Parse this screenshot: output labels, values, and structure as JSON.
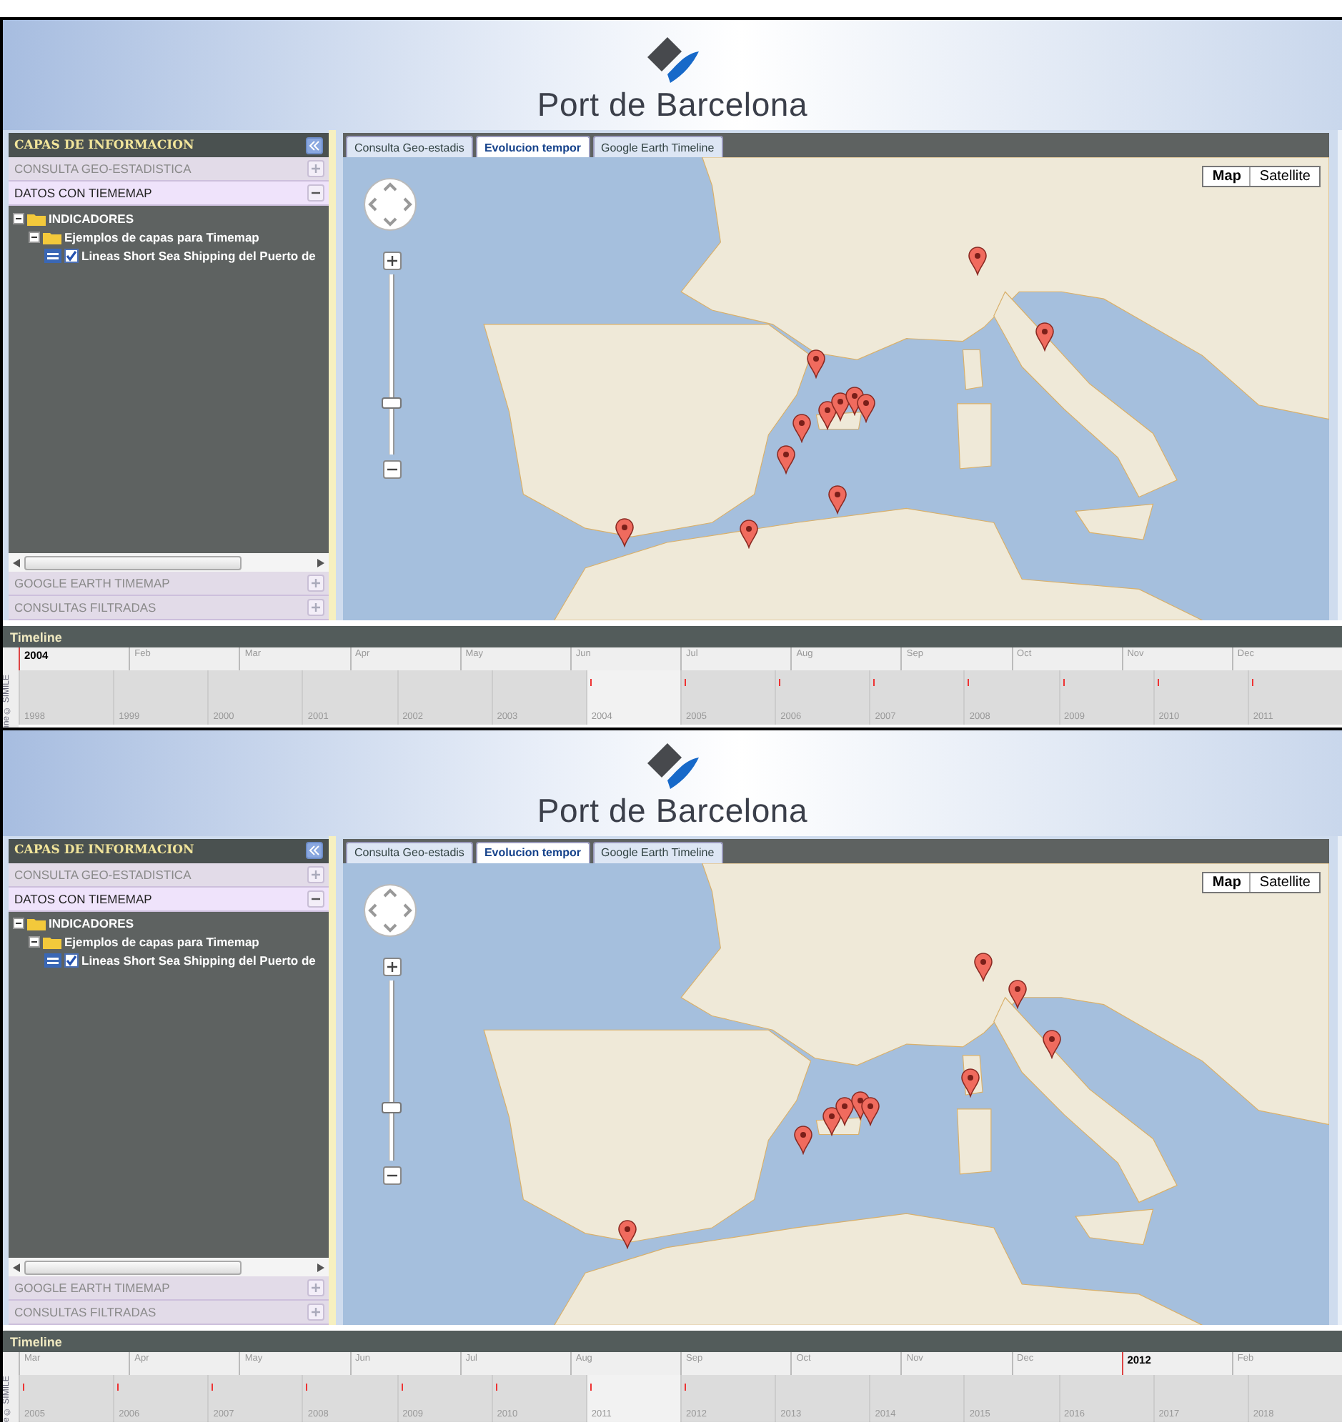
{
  "screens": [
    {
      "header": {
        "title": "Port de Barcelona"
      },
      "sidebar": {
        "title": "CAPAS DE INFORMACION",
        "sections": [
          {
            "label": "CONSULTA GEO-ESTADISTICA",
            "expanded": false
          },
          {
            "label": "DATOS CON TIEMEMAP",
            "expanded": true,
            "tree": [
              {
                "label": "INDICADORES",
                "expanded": true,
                "children": [
                  {
                    "label": "Ejemplos de capas para Timemap",
                    "expanded": true,
                    "children": [
                      {
                        "label": "Lineas Short Sea Shipping del Puerto de",
                        "checked": true
                      }
                    ]
                  }
                ]
              }
            ]
          },
          {
            "label": "GOOGLE EARTH TIMEMAP",
            "expanded": false
          },
          {
            "label": "CONSULTAS FILTRADAS",
            "expanded": false
          }
        ]
      },
      "tabs": [
        {
          "label": "Consulta Geo-estadis",
          "selected": false
        },
        {
          "label": "Evolucion tempor",
          "selected": true
        },
        {
          "label": "Google Earth Timeline",
          "selected": false
        }
      ],
      "map": {
        "zoom": {
          "level": 0.27
        },
        "map_types": [
          {
            "label": "Map",
            "selected": true
          },
          {
            "label": "Satellite",
            "selected": false
          }
        ]
      },
      "timeline": {
        "title": "Timeline",
        "credit": "ine © SIMILE",
        "upper": [
          {
            "label": "2004",
            "kind": "year"
          },
          {
            "label": "Feb",
            "kind": "month"
          },
          {
            "label": "Mar",
            "kind": "month"
          },
          {
            "label": "Apr",
            "kind": "month"
          },
          {
            "label": "May",
            "kind": "month"
          },
          {
            "label": "Jun",
            "kind": "month"
          },
          {
            "label": "Jul",
            "kind": "month"
          },
          {
            "label": "Aug",
            "kind": "month"
          },
          {
            "label": "Sep",
            "kind": "month"
          },
          {
            "label": "Oct",
            "kind": "month"
          },
          {
            "label": "Nov",
            "kind": "month"
          },
          {
            "label": "Dec",
            "kind": "month"
          }
        ],
        "lower": [
          {
            "label": "1998",
            "selected": false,
            "event": false
          },
          {
            "label": "1999",
            "selected": false,
            "event": false
          },
          {
            "label": "2000",
            "selected": false,
            "event": false
          },
          {
            "label": "2001",
            "selected": false,
            "event": false
          },
          {
            "label": "2002",
            "selected": false,
            "event": false
          },
          {
            "label": "2003",
            "selected": false,
            "event": false
          },
          {
            "label": "2004",
            "selected": true,
            "event": true
          },
          {
            "label": "2005",
            "selected": false,
            "event": true
          },
          {
            "label": "2006",
            "selected": false,
            "event": true
          },
          {
            "label": "2007",
            "selected": false,
            "event": true
          },
          {
            "label": "2008",
            "selected": false,
            "event": true
          },
          {
            "label": "2009",
            "selected": false,
            "event": true
          },
          {
            "label": "2010",
            "selected": false,
            "event": true
          },
          {
            "label": "2011",
            "selected": false,
            "event": true
          }
        ]
      }
    },
    {
      "header": {
        "title": "Port de Barcelona"
      },
      "sidebar": {
        "title": "CAPAS DE INFORMACION",
        "sections": [
          {
            "label": "CONSULTA GEO-ESTADISTICA",
            "expanded": false
          },
          {
            "label": "DATOS CON TIEMEMAP",
            "expanded": true,
            "tree": [
              {
                "label": "INDICADORES",
                "expanded": true,
                "children": [
                  {
                    "label": "Ejemplos de capas para Timemap",
                    "expanded": true,
                    "children": [
                      {
                        "label": "Lineas Short Sea Shipping del Puerto de",
                        "checked": true
                      }
                    ]
                  }
                ]
              }
            ]
          },
          {
            "label": "GOOGLE EARTH TIMEMAP",
            "expanded": false
          },
          {
            "label": "CONSULTAS FILTRADAS",
            "expanded": false
          }
        ]
      },
      "tabs": [
        {
          "label": "Consulta Geo-estadis",
          "selected": false
        },
        {
          "label": "Evolucion tempor",
          "selected": true
        },
        {
          "label": "Google Earth Timeline",
          "selected": false
        }
      ],
      "map": {
        "zoom": {
          "level": 0.28
        },
        "map_types": [
          {
            "label": "Map",
            "selected": true
          },
          {
            "label": "Satellite",
            "selected": false
          }
        ]
      },
      "timeline": {
        "title": "Timeline",
        "credit": "e © SIMILE",
        "upper": [
          {
            "label": "Mar",
            "kind": "month"
          },
          {
            "label": "Apr",
            "kind": "month"
          },
          {
            "label": "May",
            "kind": "month"
          },
          {
            "label": "Jun",
            "kind": "month"
          },
          {
            "label": "Jul",
            "kind": "month"
          },
          {
            "label": "Aug",
            "kind": "month"
          },
          {
            "label": "Sep",
            "kind": "month"
          },
          {
            "label": "Oct",
            "kind": "month"
          },
          {
            "label": "Nov",
            "kind": "month"
          },
          {
            "label": "Dec",
            "kind": "month"
          },
          {
            "label": "2012",
            "kind": "year"
          },
          {
            "label": "Feb",
            "kind": "month"
          }
        ],
        "lower": [
          {
            "label": "2005",
            "selected": false,
            "event": true
          },
          {
            "label": "2006",
            "selected": false,
            "event": true
          },
          {
            "label": "2007",
            "selected": false,
            "event": true
          },
          {
            "label": "2008",
            "selected": false,
            "event": true
          },
          {
            "label": "2009",
            "selected": false,
            "event": true
          },
          {
            "label": "2010",
            "selected": false,
            "event": true
          },
          {
            "label": "2011",
            "selected": true,
            "event": true
          },
          {
            "label": "2012",
            "selected": false,
            "event": true
          },
          {
            "label": "2013",
            "selected": false,
            "event": false
          },
          {
            "label": "2014",
            "selected": false,
            "event": false
          },
          {
            "label": "2015",
            "selected": false,
            "event": false
          },
          {
            "label": "2016",
            "selected": false,
            "event": false
          },
          {
            "label": "2017",
            "selected": false,
            "event": false
          },
          {
            "label": "2018",
            "selected": false,
            "event": false
          }
        ]
      }
    }
  ]
}
